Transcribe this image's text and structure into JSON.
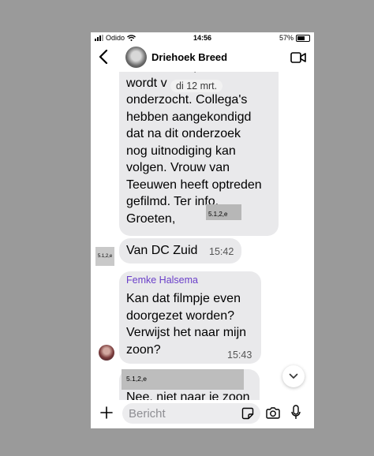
{
  "status": {
    "carrier": "Odido",
    "time": "14:56",
    "battery": "57%"
  },
  "header": {
    "title": "Driehoek Breed"
  },
  "messages": [
    {
      "lines": "luchtdrukwapen maar\nwordt v\nonderzocht. Collega's\nhebben aangekondigd\ndat na dit onderzoek\nnog uitnodiging kan\nvolgen. Vrouw van\nTeeuwen heeft optreden\ngefilmd. Ter info.\nGroeten,",
      "redaction": "5.1,2,e"
    },
    {
      "text": "Van DC Zuid",
      "time": "15:42",
      "avatar_redaction": "5.1,2,e"
    },
    {
      "sender": "Femke Halsema",
      "lines": "Kan dat filmpje even\ndoorgezet worden?\nVerwijst het naar mijn\nzoon?",
      "time": "15:43"
    },
    {
      "redaction": "5.1,2,e",
      "text": "Nee, niet naar je zoon"
    }
  ],
  "date_pill": "di 12 mrt.",
  "input": {
    "placeholder": "Bericht"
  },
  "colors": {
    "sender": "#6a3fc9",
    "bubble": "#e9e9eb",
    "backdrop": "#9a9a9a"
  },
  "icons": [
    "back-chevron-icon",
    "video-call-icon",
    "scroll-down-icon",
    "plus-icon",
    "sticker-icon",
    "camera-icon",
    "microphone-icon"
  ]
}
